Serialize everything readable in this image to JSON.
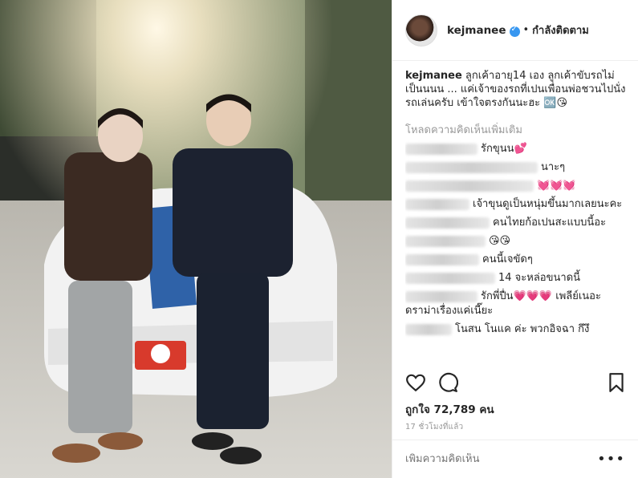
{
  "post": {
    "username": "kejmanee",
    "follow_status": "กำลังติดตาม",
    "caption_user": "kejmanee",
    "caption_text": "ลูกเค้าอายุ14 เอง ลูกเค้าขับรถไม่เป็นนนน ... แค่เจ้าของรถที่เปนเพื่อนพ่อชวนไปนั่งรถเล่นครับ เข้าใจตรงกันนะฮะ 🆗😘",
    "load_more": "โหลดความคิดเห็นเพิ่มเติม",
    "comments": [
      {
        "user": "",
        "text": "รักขุนน💕"
      },
      {
        "user": "",
        "text": "นาะๆ"
      },
      {
        "user": "",
        "text": "💓💓💓"
      },
      {
        "user": "",
        "text": "เจ้าขุนดูเป็นหนุ่มขึ้นมากเลยนะคะ"
      },
      {
        "user": "",
        "text": "คนไทยก้อเปนสะแบบนี้อะ"
      },
      {
        "user": "",
        "text": "😘😘"
      },
      {
        "user": "",
        "text": "คนนี้เจขัดๆ"
      },
      {
        "user": "",
        "text": "14 จะหล่อขนาดนี้"
      },
      {
        "user": "",
        "text": "รักพี่ปื่น💗💗💗 เพลีย์เนอะดราม่าเรื่องแค่เนี๊ยะ"
      },
      {
        "user": "",
        "text": "โนสน โนแค ค่ะ พวกอิจฉา กึงึ"
      }
    ],
    "likes_text": "ถูกใจ 72,789 คน",
    "time_text": "17 ชั่วโมงที่แล้ว",
    "add_comment_placeholder": "เพิ่มความคิดเห็น",
    "more_label": "•••"
  },
  "icons": {
    "heart": "heart-icon",
    "comment": "comment-icon",
    "bookmark": "bookmark-icon",
    "verified": "verified-badge-icon"
  },
  "colors": {
    "verified_blue": "#3897f0",
    "text": "#262626",
    "muted": "#999999"
  }
}
